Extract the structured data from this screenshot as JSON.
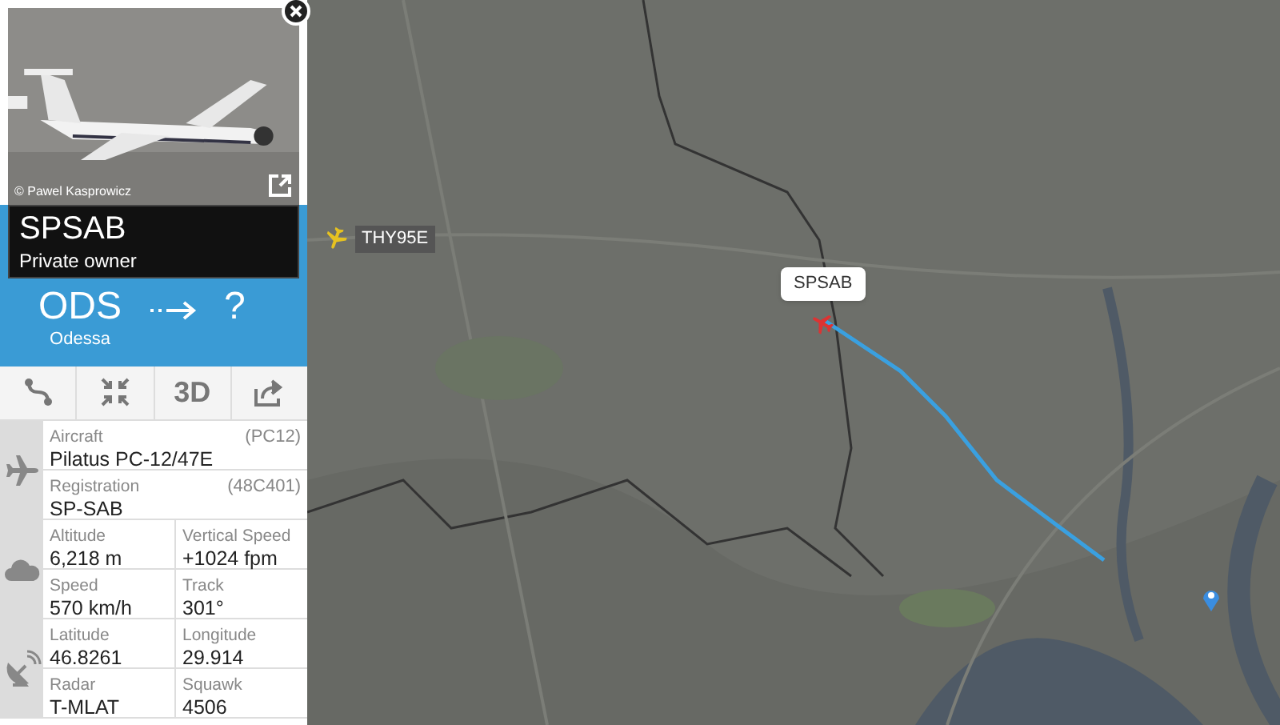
{
  "photo": {
    "credit": "© Pawel Kasprowicz"
  },
  "flight": {
    "callsign": "SPSAB",
    "operator": "Private owner"
  },
  "route": {
    "origin_code": "ODS",
    "origin_city": "Odessa",
    "destination_code": "?"
  },
  "toolbar": [
    {
      "kind": "route"
    },
    {
      "kind": "collapse"
    },
    {
      "kind": "view3d",
      "label": "3D"
    },
    {
      "kind": "share"
    }
  ],
  "details": [
    {
      "rows": [
        [
          {
            "label": "Aircraft",
            "value": "Pilatus PC-12/47E",
            "code": "(PC12)"
          }
        ],
        [
          {
            "label": "Registration",
            "value": "SP-SAB",
            "code": "(48C401)"
          }
        ]
      ]
    },
    {
      "rows": [
        [
          {
            "label": "Altitude",
            "value": "6,218 m"
          },
          {
            "label": "Vertical Speed",
            "value": "+1024 fpm"
          }
        ],
        [
          {
            "label": "Speed",
            "value": "570 km/h"
          },
          {
            "label": "Track",
            "value": "301°"
          }
        ]
      ]
    },
    {
      "rows": [
        [
          {
            "label": "Latitude",
            "value": "46.8261"
          },
          {
            "label": "Longitude",
            "value": "29.914"
          }
        ],
        [
          {
            "label": "Radar",
            "value": "T-MLAT"
          },
          {
            "label": "Squawk",
            "value": "4506"
          }
        ]
      ]
    }
  ],
  "map": {
    "markers": [
      {
        "label": "THY95E",
        "selected": false
      },
      {
        "label": "SPSAB",
        "selected": true
      }
    ]
  }
}
